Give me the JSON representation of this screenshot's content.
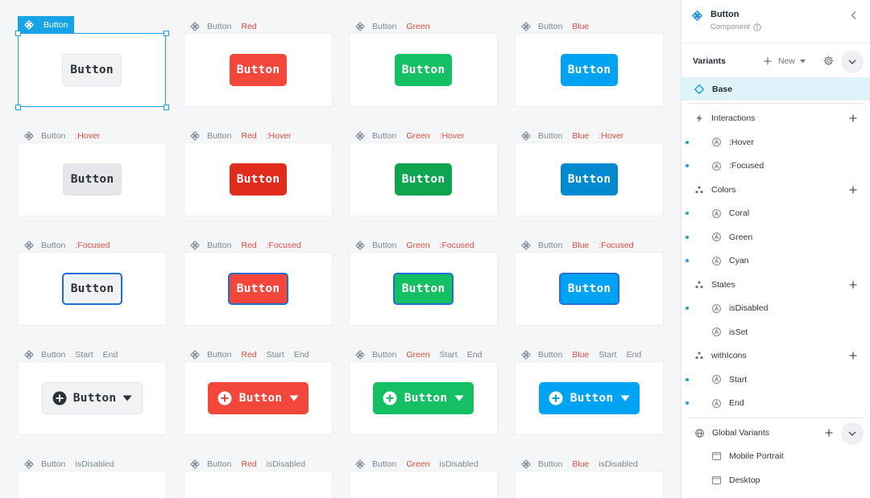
{
  "canvas": {
    "selection_tag": "Button",
    "rows": [
      {
        "cells": [
          {
            "labels": [
              "Button"
            ],
            "label_red": [],
            "variant": "base",
            "state": "normal",
            "button_label": "Button",
            "selected": true
          },
          {
            "labels": [
              "Button"
            ],
            "label_red": [
              "Red"
            ],
            "variant": "coral",
            "state": "normal",
            "button_label": "Button"
          },
          {
            "labels": [
              "Button"
            ],
            "label_red": [
              "Green"
            ],
            "variant": "green",
            "state": "normal",
            "button_label": "Button"
          },
          {
            "labels": [
              "Button"
            ],
            "label_red": [
              "Blue"
            ],
            "variant": "blue",
            "state": "normal",
            "button_label": "Button"
          }
        ]
      },
      {
        "cells": [
          {
            "labels": [
              "Button"
            ],
            "label_red": [
              ":Hover"
            ],
            "variant": "base",
            "state": "hover",
            "button_label": "Button"
          },
          {
            "labels": [
              "Button"
            ],
            "label_red": [
              "Red",
              ":Hover"
            ],
            "variant": "coral",
            "state": "hover",
            "button_label": "Button"
          },
          {
            "labels": [
              "Button"
            ],
            "label_red": [
              "Green",
              ":Hover"
            ],
            "variant": "green",
            "state": "hover",
            "button_label": "Button"
          },
          {
            "labels": [
              "Button"
            ],
            "label_red": [
              "Blue",
              ":Hover"
            ],
            "variant": "blue",
            "state": "hover",
            "button_label": "Button"
          }
        ]
      },
      {
        "cells": [
          {
            "labels": [
              "Button"
            ],
            "label_red": [
              ":Focused"
            ],
            "variant": "base",
            "state": "focused",
            "button_label": "Button"
          },
          {
            "labels": [
              "Button"
            ],
            "label_red": [
              "Red",
              ":Focused"
            ],
            "variant": "coral",
            "state": "focused",
            "button_label": "Button"
          },
          {
            "labels": [
              "Button"
            ],
            "label_red": [
              "Green",
              ":Focused"
            ],
            "variant": "green",
            "state": "focused",
            "button_label": "Button"
          },
          {
            "labels": [
              "Button"
            ],
            "label_red": [
              "Blue",
              ":Focused"
            ],
            "variant": "blue",
            "state": "focused",
            "button_label": "Button"
          }
        ]
      },
      {
        "cells": [
          {
            "labels": [
              "Button"
            ],
            "label_red": [],
            "label_after": [
              "Start",
              "End"
            ],
            "variant": "base",
            "state": "icons",
            "button_label": "Button"
          },
          {
            "labels": [
              "Button"
            ],
            "label_red": [
              "Red"
            ],
            "label_after": [
              "Start",
              "End"
            ],
            "variant": "coral",
            "state": "icons",
            "button_label": "Button"
          },
          {
            "labels": [
              "Button"
            ],
            "label_red": [
              "Green"
            ],
            "label_after": [
              "Start",
              "End"
            ],
            "variant": "green",
            "state": "icons",
            "button_label": "Button"
          },
          {
            "labels": [
              "Button"
            ],
            "label_red": [
              "Blue"
            ],
            "label_after": [
              "Start",
              "End"
            ],
            "variant": "blue",
            "state": "icons",
            "button_label": "Button"
          }
        ]
      },
      {
        "cells": [
          {
            "labels": [
              "Button"
            ],
            "label_red": [],
            "label_after": [
              "isDisabled"
            ],
            "variant": "base",
            "state": "disabled",
            "button_label": ""
          },
          {
            "labels": [
              "Button"
            ],
            "label_red": [
              "Red"
            ],
            "label_after": [
              "isDisabled"
            ],
            "variant": "coral",
            "state": "disabled",
            "button_label": ""
          },
          {
            "labels": [
              "Button"
            ],
            "label_red": [
              "Green"
            ],
            "label_after": [
              "isDisabled"
            ],
            "variant": "green",
            "state": "disabled",
            "button_label": ""
          },
          {
            "labels": [
              "Button"
            ],
            "label_red": [
              "Blue"
            ],
            "label_after": [
              "isDisabled"
            ],
            "variant": "blue",
            "state": "disabled",
            "button_label": ""
          }
        ]
      }
    ]
  },
  "panel": {
    "title": "Button",
    "subtitle": "Component",
    "variants_label": "Variants",
    "new_label": "New",
    "base_label": "Base",
    "groups": [
      {
        "name": "Interactions",
        "icon": "bolt-icon",
        "items": [
          ":Hover",
          ":Focused"
        ]
      },
      {
        "name": "Colors",
        "icon": "triangle-dots-icon",
        "items": [
          "Coral",
          "Green",
          "Cyan"
        ]
      },
      {
        "name": "States",
        "icon": "triangle-dots-icon",
        "items": [
          "isDisabled",
          "isSet"
        ]
      },
      {
        "name": "withIcons",
        "icon": "triangle-dots-icon",
        "items": [
          "Start",
          "End"
        ]
      }
    ],
    "global_variants_label": "Global Variants",
    "global_variants": [
      "Mobile Portrait",
      "Desktop"
    ]
  },
  "colors": {
    "selection": "#17a3e6",
    "coral": "#f4473b",
    "green": "#14c063",
    "blue": "#00a3f4",
    "label_accent": "#e8493c"
  }
}
